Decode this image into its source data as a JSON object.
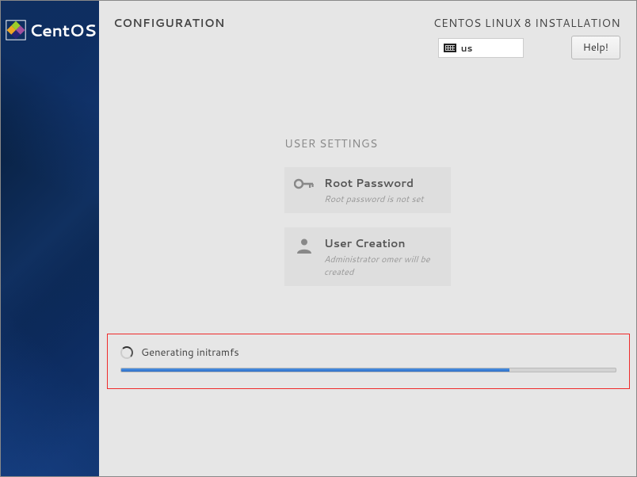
{
  "brand": {
    "name": "CentOS"
  },
  "header": {
    "configuration_label": "CONFIGURATION",
    "installation_label": "CENTOS LINUX 8 INSTALLATION",
    "keyboard_layout": "us",
    "help_label": "Help!"
  },
  "user_settings": {
    "heading": "USER SETTINGS",
    "root_password": {
      "title": "Root Password",
      "subtitle": "Root password is not set"
    },
    "user_creation": {
      "title": "User Creation",
      "subtitle": "Administrator omer will be created"
    }
  },
  "progress": {
    "status_text": "Generating initramfs",
    "percent": 78.5
  }
}
